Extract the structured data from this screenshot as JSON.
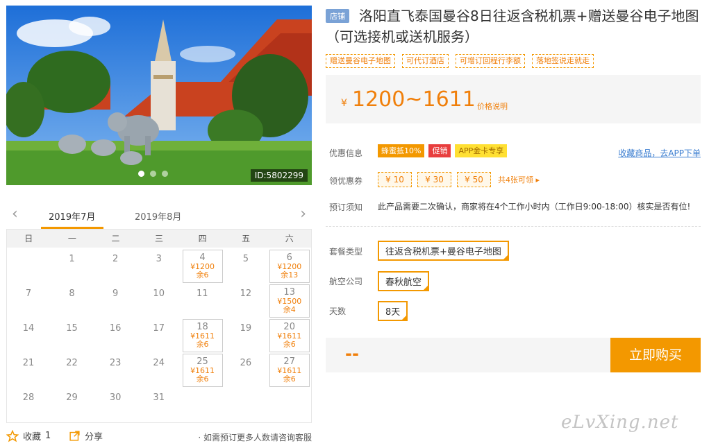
{
  "hero": {
    "image_id": "ID:5802299",
    "dots": 3,
    "active_dot": 0
  },
  "calendar": {
    "months": [
      "2019年7月",
      "2019年8月"
    ],
    "active_month": 0,
    "weekdays": [
      "日",
      "一",
      "二",
      "三",
      "四",
      "五",
      "六"
    ],
    "weeks": [
      [
        null,
        {
          "d": "1"
        },
        {
          "d": "2"
        },
        {
          "d": "3"
        },
        {
          "d": "4",
          "p": "¥1200",
          "s": "余6"
        },
        {
          "d": "5"
        },
        {
          "d": "6",
          "p": "¥1200",
          "s": "余13"
        }
      ],
      [
        {
          "d": "7"
        },
        {
          "d": "8"
        },
        {
          "d": "9"
        },
        {
          "d": "10"
        },
        {
          "d": "11"
        },
        {
          "d": "12"
        },
        {
          "d": "13",
          "p": "¥1500",
          "s": "余4"
        }
      ],
      [
        {
          "d": "14"
        },
        {
          "d": "15"
        },
        {
          "d": "16"
        },
        {
          "d": "17"
        },
        {
          "d": "18",
          "p": "¥1611",
          "s": "余6"
        },
        {
          "d": "19"
        },
        {
          "d": "20",
          "p": "¥1611",
          "s": "余6"
        }
      ],
      [
        {
          "d": "21"
        },
        {
          "d": "22"
        },
        {
          "d": "23"
        },
        {
          "d": "24"
        },
        {
          "d": "25",
          "p": "¥1611",
          "s": "余6"
        },
        {
          "d": "26"
        },
        {
          "d": "27",
          "p": "¥1611",
          "s": "余6"
        }
      ],
      [
        {
          "d": "28"
        },
        {
          "d": "29"
        },
        {
          "d": "30"
        },
        {
          "d": "31"
        },
        null,
        null,
        null
      ]
    ]
  },
  "actions": {
    "fav_label": "收藏",
    "fav_count": "1",
    "share_label": "分享",
    "consult": "· 如需预订更多人数请咨询客服"
  },
  "product": {
    "shop_badge": "店铺",
    "title": "洛阳直飞泰国曼谷8日往返含税机票+赠送曼谷电子地图（可选接机或送机服务）",
    "tags": [
      "赠送曼谷电子地图",
      "可代订酒店",
      "可增订回程行李额",
      "落地签说走就走"
    ],
    "price_symbol": "¥",
    "price": "1200~1611",
    "price_note": "价格说明",
    "promo_label": "优惠信息",
    "promos": [
      "蜂蜜抵10%",
      "促销",
      "APP金卡专享"
    ],
    "fav_link": "收藏商品，去APP下单",
    "coupon_label": "领优惠券",
    "coupons": [
      "¥ 10",
      "¥ 30",
      "¥ 50"
    ],
    "coupon_more": "共4张可领 ▸",
    "notice_label": "预订须知",
    "notice": "此产品需要二次确认，商家将在4个工作小时内（工作日9:00-18:00）核实是否有位!",
    "package_label": "套餐类型",
    "package_value": "往返含税机票+曼谷电子地图",
    "airline_label": "航空公司",
    "airline_value": "春秋航空",
    "days_label": "天数",
    "days_value": "8天",
    "total": "--",
    "buy_label": "立即购买"
  },
  "watermark": "eLvXing.net",
  "colors": {
    "accent": "#f39800",
    "price": "#f07f0a",
    "sale": "#e83e3e",
    "link": "#3a7dd0"
  }
}
